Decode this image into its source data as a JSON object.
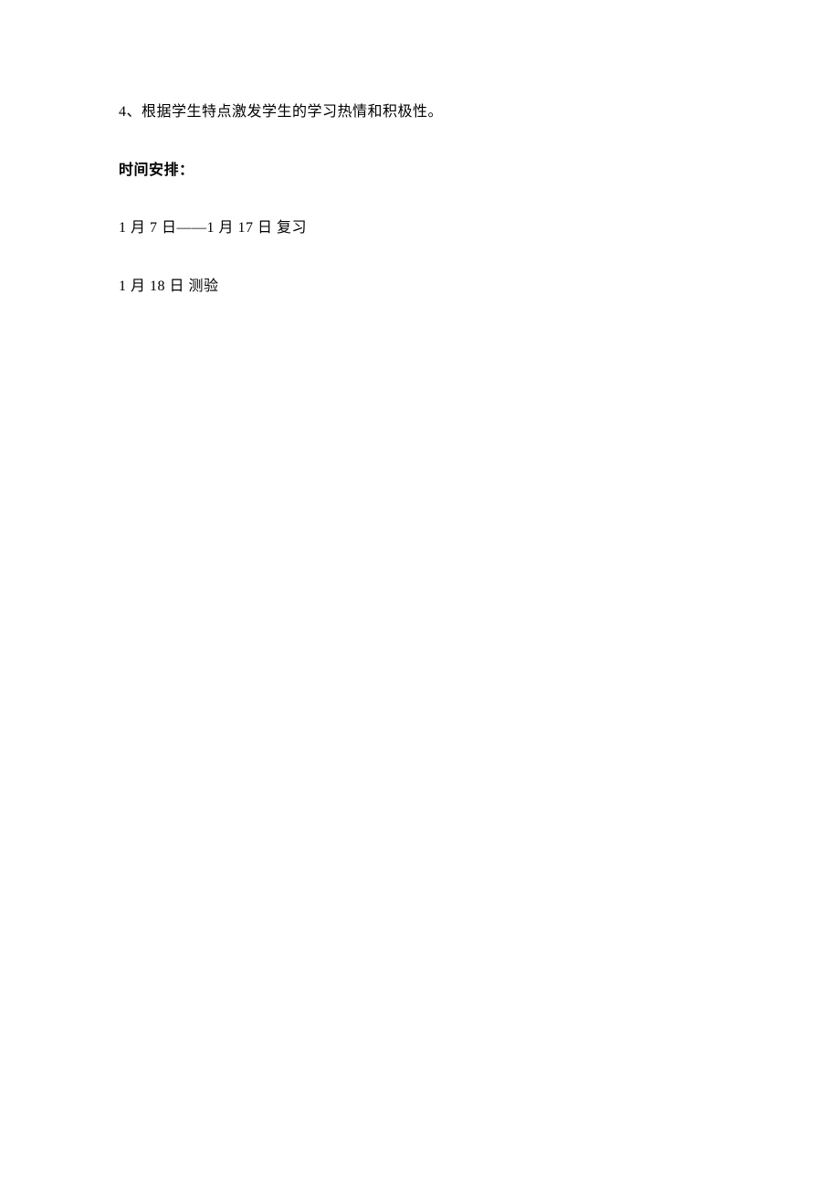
{
  "content": {
    "line1": "4、根据学生特点激发学生的学习热情和积极性。",
    "line2": "时间安排：",
    "line3": "1 月 7 日——1 月 17 日 复习",
    "line4": "1 月 18 日 测验"
  }
}
